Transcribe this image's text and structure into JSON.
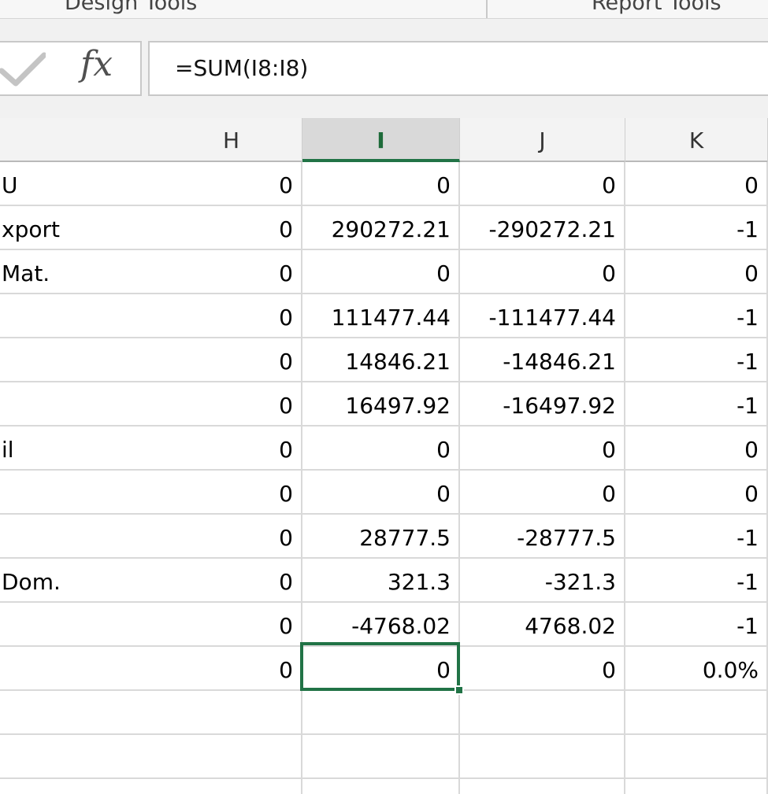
{
  "ribbon": {
    "left_tab": "Design Tools",
    "right_tab": "Report Tools"
  },
  "formula_bar": {
    "enter_icon": "check-icon",
    "function_icon": "fx-icon",
    "function_label": "fx",
    "formula": "=SUM(I8:I8)"
  },
  "grid": {
    "columns": [
      "",
      "H",
      "I",
      "J",
      "K"
    ],
    "selected_column": "I",
    "rows": [
      {
        "label": "U",
        "h": "0",
        "i": "0",
        "j": "0",
        "k": "0"
      },
      {
        "label": "xport",
        "h": "0",
        "i": "290272.21",
        "j": "-290272.21",
        "k": "-1"
      },
      {
        "label": "Mat.",
        "h": "0",
        "i": "0",
        "j": "0",
        "k": "0"
      },
      {
        "label": "",
        "h": "0",
        "i": "111477.44",
        "j": "-111477.44",
        "k": "-1"
      },
      {
        "label": "",
        "h": "0",
        "i": "14846.21",
        "j": "-14846.21",
        "k": "-1"
      },
      {
        "label": "",
        "h": "0",
        "i": "16497.92",
        "j": "-16497.92",
        "k": "-1"
      },
      {
        "label": "il",
        "h": "0",
        "i": "0",
        "j": "0",
        "k": "0"
      },
      {
        "label": "",
        "h": "0",
        "i": "0",
        "j": "0",
        "k": "0"
      },
      {
        "label": "",
        "h": "0",
        "i": "28777.5",
        "j": "-28777.5",
        "k": "-1"
      },
      {
        "label": "Dom.",
        "h": "0",
        "i": "321.3",
        "j": "-321.3",
        "k": "-1"
      },
      {
        "label": "",
        "h": "0",
        "i": "-4768.02",
        "j": "4768.02",
        "k": "-1"
      },
      {
        "label": "",
        "h": "0",
        "i": "0",
        "j": "0",
        "k": "0.0%"
      },
      {
        "label": "",
        "h": "",
        "i": "",
        "j": "",
        "k": ""
      },
      {
        "label": "",
        "h": "",
        "i": "",
        "j": "",
        "k": ""
      },
      {
        "label": "",
        "h": "",
        "i": "",
        "j": "",
        "k": ""
      }
    ]
  },
  "colors": {
    "accent": "#217346",
    "gridline": "#d9d9d9",
    "header_bg": "#f3f3f3"
  }
}
